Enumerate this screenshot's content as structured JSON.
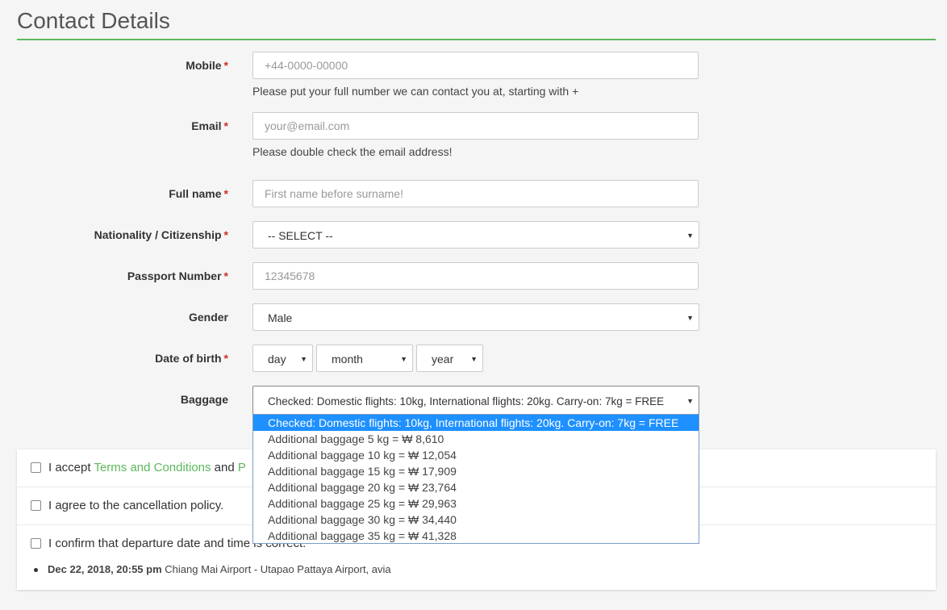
{
  "page_title": "Contact Details",
  "fields": {
    "mobile": {
      "label": "Mobile",
      "required": "*",
      "placeholder": "+44-0000-00000",
      "help": "Please put your full number we can contact you at, starting with +"
    },
    "email": {
      "label": "Email",
      "required": "*",
      "placeholder": "your@email.com",
      "help": "Please double check the email address!"
    },
    "full_name": {
      "label": "Full name",
      "required": "*",
      "placeholder": "First name before surname!"
    },
    "nationality": {
      "label": "Nationality / Citizenship",
      "required": "*",
      "selected": "-- SELECT --"
    },
    "passport": {
      "label": "Passport Number",
      "required": "*",
      "placeholder": "12345678"
    },
    "gender": {
      "label": "Gender",
      "selected": "Male"
    },
    "dob": {
      "label": "Date of birth",
      "required": "*",
      "day": "day",
      "month": "month",
      "year": "year"
    },
    "baggage": {
      "label": "Baggage",
      "selected": "Checked: Domestic flights: 10kg, International flights: 20kg. Carry-on: 7kg = FREE",
      "options": [
        "Checked: Domestic flights: 10kg, International flights: 20kg. Carry-on: 7kg = FREE",
        "Additional baggage 5 kg = ₩ 8,610",
        "Additional baggage 10 kg = ₩ 12,054",
        "Additional baggage 15 kg = ₩ 17,909",
        "Additional baggage 20 kg = ₩ 23,764",
        "Additional baggage 25 kg = ₩ 29,963",
        "Additional baggage 30 kg = ₩ 34,440",
        "Additional baggage 35 kg = ₩ 41,328"
      ]
    }
  },
  "agreements": {
    "terms_prefix": "I accept ",
    "terms_link": "Terms and Conditions",
    "terms_and": " and ",
    "terms_link2": "P",
    "cancellation": "I agree to the cancellation policy.",
    "departure": "I confirm that departure date and time is correct.",
    "flight_datetime": "Dec 22, 2018, 20:55 pm",
    "flight_route": " Chiang Mai Airport - Utapao Pattaya Airport, avia"
  },
  "colors": {
    "accent": "#5cb85c",
    "required": "#c9302c",
    "dropdown_highlight": "#1e90ff"
  }
}
